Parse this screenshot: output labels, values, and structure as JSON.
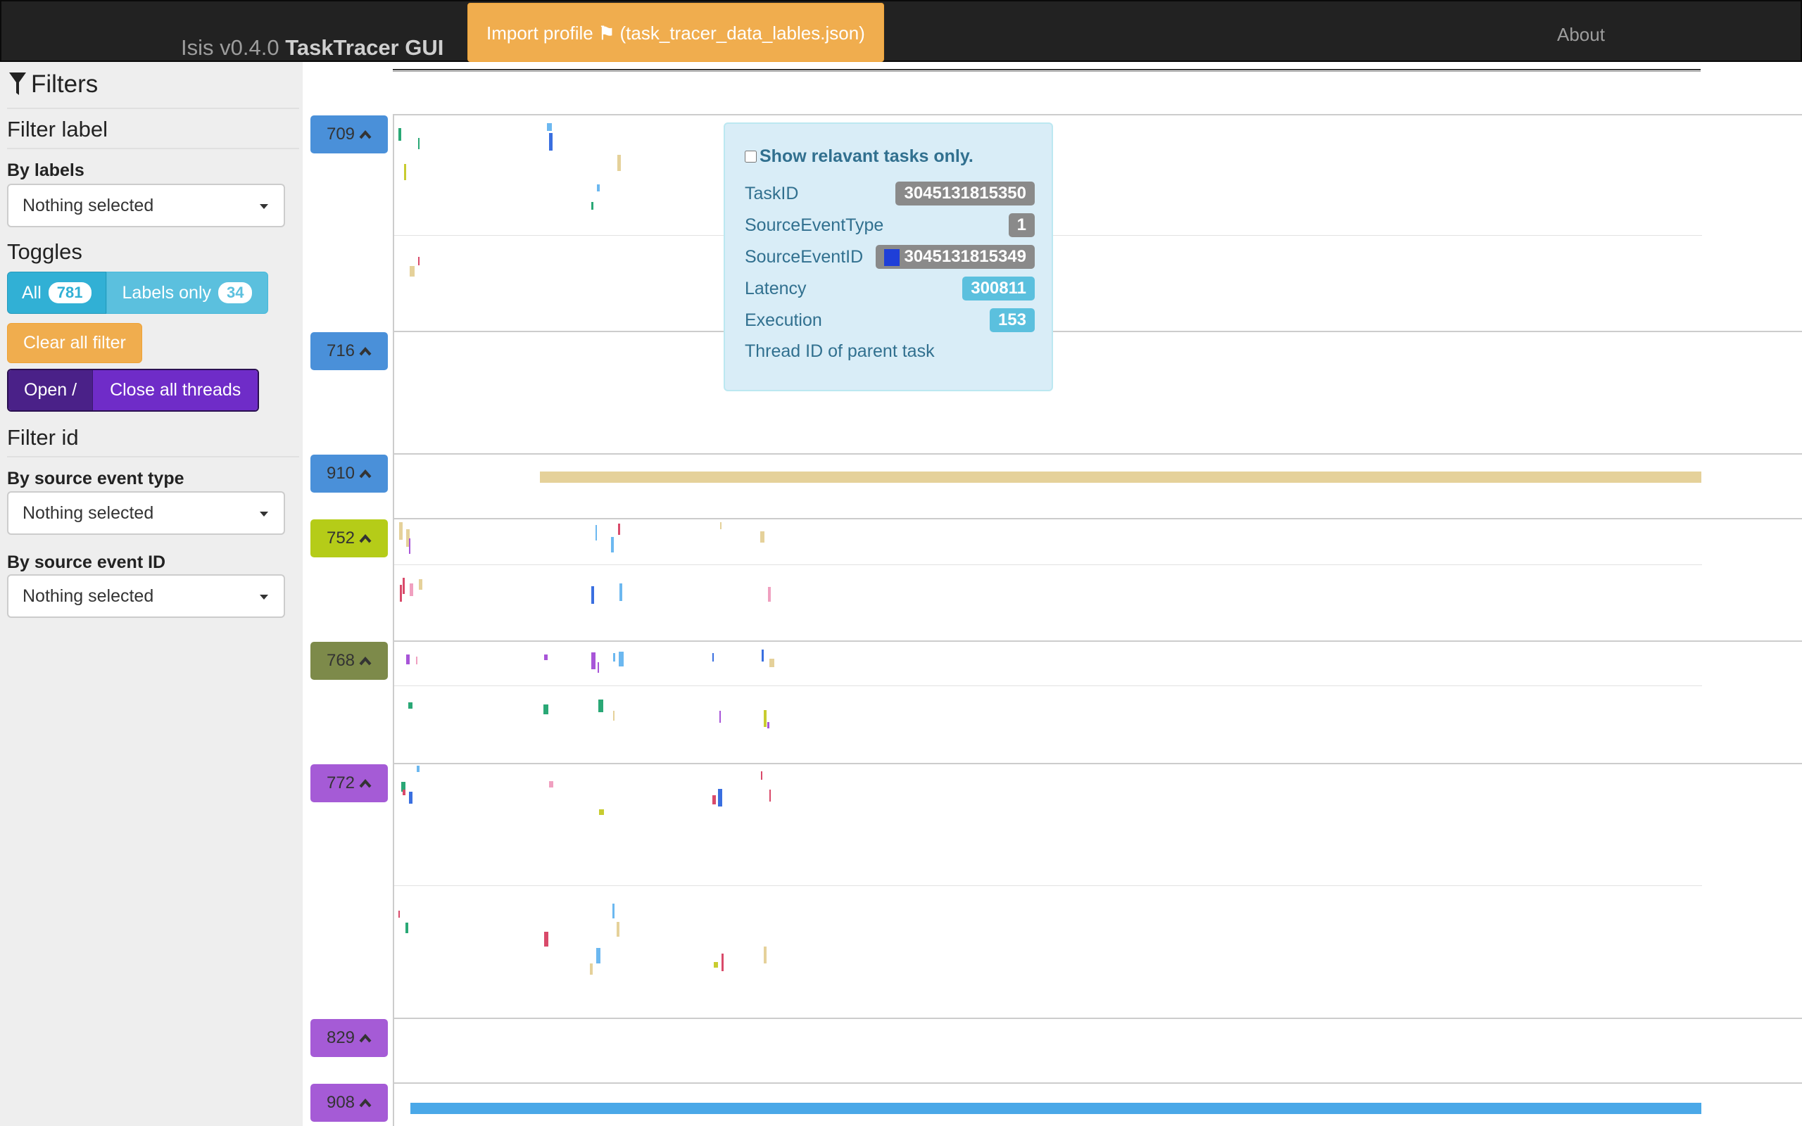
{
  "navbar": {
    "brand_version": "Isis v0.4.0",
    "brand_name": "TaskTracer GUI",
    "import_label": "Import profile",
    "import_file": "(task_tracer_data_lables.json)",
    "about": "About"
  },
  "sidebar": {
    "title": "Filters",
    "filter_label_heading": "Filter label",
    "by_labels": "By labels",
    "labels_select_value": "Nothing selected",
    "toggles_heading": "Toggles",
    "all_label": "All",
    "all_count": "781",
    "labels_only_label": "Labels only",
    "labels_only_count": "34",
    "clear_all": "Clear all filter",
    "open_label": "Open /",
    "close_label": "Close all threads",
    "filter_id_heading": "Filter id",
    "by_source_event_type": "By source event type",
    "source_event_type_value": "Nothing selected",
    "by_source_event_id": "By source event ID",
    "source_event_id_value": "Nothing selected"
  },
  "threads": [
    {
      "id": "709",
      "color": "#4a90d9"
    },
    {
      "id": "716",
      "color": "#4a90d9"
    },
    {
      "id": "910",
      "color": "#4a90d9"
    },
    {
      "id": "752",
      "color": "#b5cc18"
    },
    {
      "id": "768",
      "color": "#7d8a4a"
    },
    {
      "id": "772",
      "color": "#a55bd6"
    },
    {
      "id": "829",
      "color": "#a55bd6"
    },
    {
      "id": "908",
      "color": "#a55bd6"
    }
  ],
  "tooltip": {
    "checkbox_label": "Show relavant tasks only.",
    "task_id_label": "TaskID",
    "task_id_value": "3045131815350",
    "source_event_type_label": "SourceEventType",
    "source_event_type_value": "1",
    "source_event_id_label": "SourceEventID",
    "source_event_id_value": "3045131815349",
    "latency_label": "Latency",
    "latency_value": "300811",
    "execution_label": "Execution",
    "execution_value": "153",
    "parent_thread_label": "Thread ID of parent task"
  },
  "colors": {
    "navbar_bg": "#222222",
    "warning": "#f0ad4e",
    "info": "#5bc0de",
    "purple": "#6f2cc8",
    "long_task_910": "#e5d19a",
    "long_task_908": "#4aa8e8"
  }
}
